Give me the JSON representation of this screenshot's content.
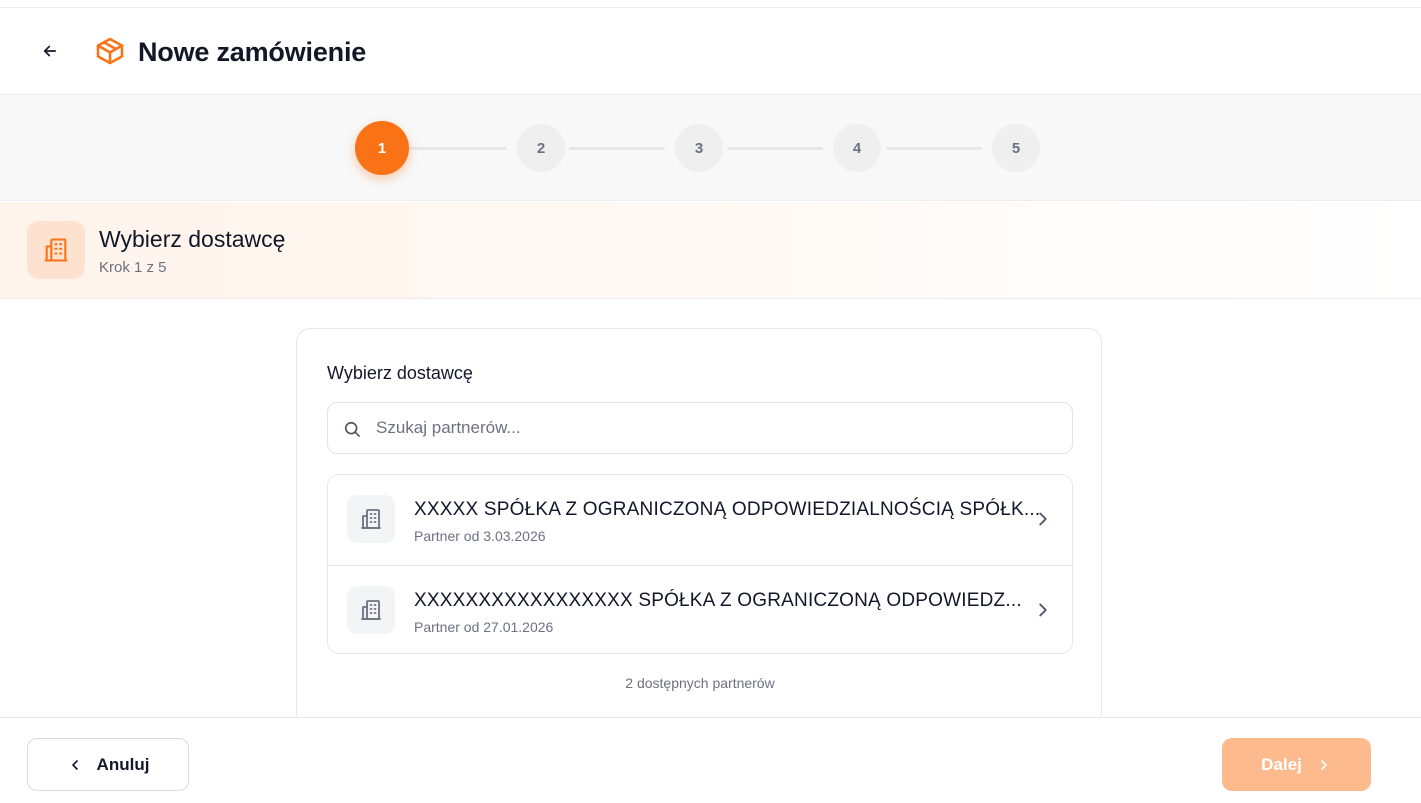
{
  "header": {
    "title": "Nowe zamówienie",
    "back_icon": "arrow-left-icon",
    "title_icon": "package-box-icon",
    "accent_color": "#f97316"
  },
  "stepper": {
    "steps": [
      {
        "label": "1",
        "state": "active"
      },
      {
        "label": "2",
        "state": "upcoming"
      },
      {
        "label": "3",
        "state": "upcoming"
      },
      {
        "label": "4",
        "state": "upcoming"
      },
      {
        "label": "5",
        "state": "upcoming"
      }
    ]
  },
  "section": {
    "icon": "building-icon",
    "title": "Wybierz dostawcę",
    "subtitle": "Krok 1 z 5"
  },
  "card": {
    "title": "Wybierz dostawcę",
    "search": {
      "placeholder": "Szukaj partnerów...",
      "value": ""
    },
    "partners": [
      {
        "name": "XXXXX SPÓŁKA Z OGRANICZONĄ ODPOWIEDZIALNOŚCIĄ SPÓŁK...",
        "since": "Partner od 3.03.2026"
      },
      {
        "name": "XXXXXXXXXXXXXXXXX SPÓŁKA Z OGRANICZONĄ ODPOWIEDZ...",
        "since": "Partner od 27.01.2026"
      }
    ],
    "count_label": "2 dostępnych partnerów"
  },
  "footer": {
    "cancel_label": "Anuluj",
    "next_label": "Dalej",
    "next_enabled": false
  }
}
